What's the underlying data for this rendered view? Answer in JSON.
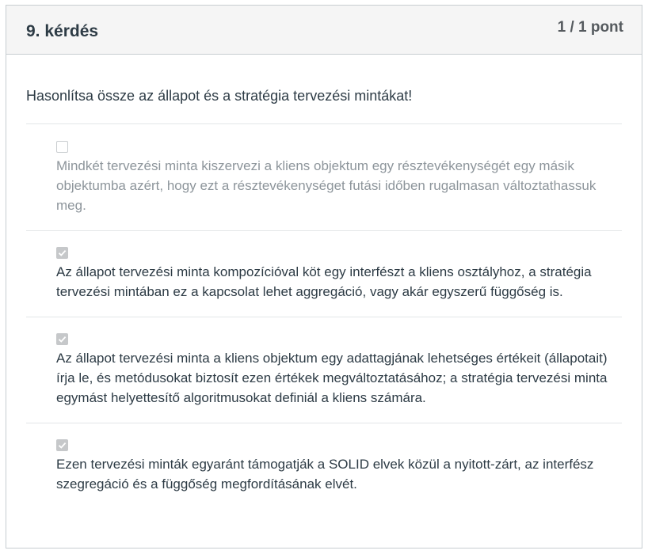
{
  "question": {
    "title": "9. kérdés",
    "points": "1 / 1 pont",
    "text": "Hasonlítsa össze az állapot és a stratégia tervezési mintákat!"
  },
  "answers": [
    {
      "checked": false,
      "text": "Mindkét tervezési minta kiszervezi a kliens objektum egy résztevékenységét egy másik objektumba azért, hogy ezt a résztevékenységet futási időben rugalmasan változtathassuk meg."
    },
    {
      "checked": true,
      "text": "Az állapot tervezési minta kompozícióval köt egy interfészt a kliens osztályhoz, a stratégia tervezési mintában ez a kapcsolat lehet aggregáció, vagy akár egyszerű függőség is."
    },
    {
      "checked": true,
      "text": "Az állapot tervezési minta a kliens objektum egy adattagjának lehetséges értékeit (állapotait) írja le, és metódusokat biztosít ezen értékek megváltoztatásához; a stratégia tervezési minta egymást helyettesítő algoritmusokat definiál a kliens számára."
    },
    {
      "checked": true,
      "text": "Ezen tervezési minták egyaránt támogatják a SOLID elvek közül a nyitott-zárt, az interfész szegregáció és a függőség megfordításának elvét."
    }
  ],
  "icons": {
    "checkbox_checked": "checkmark-icon"
  },
  "colors": {
    "header_bg": "#f5f5f5",
    "text": "#2d3b45",
    "muted_text": "#8d959b",
    "checkbox_checked": "#c6c8ca"
  }
}
